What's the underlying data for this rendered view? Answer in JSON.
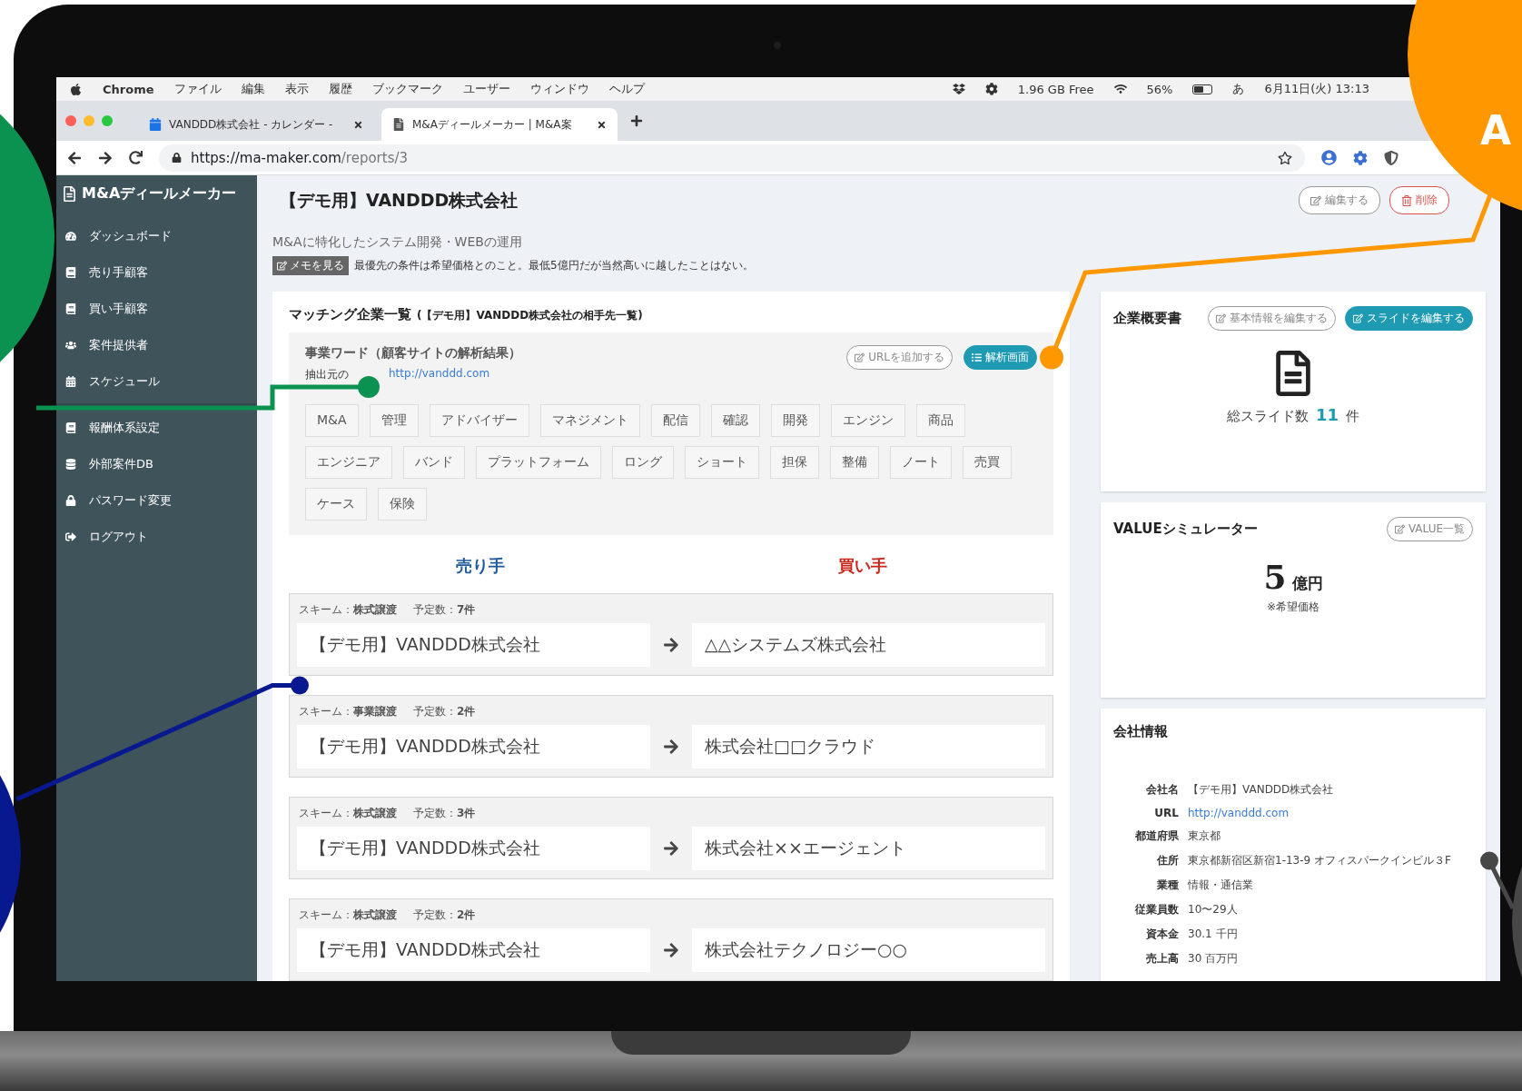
{
  "menubar": {
    "app": "Chrome",
    "menus": [
      "ファイル",
      "編集",
      "表示",
      "履歴",
      "ブックマーク",
      "ユーザー",
      "ウィンドウ",
      "ヘルプ"
    ],
    "memory": "1.96 GB Free",
    "battery": "56%",
    "ime": "あ",
    "clock": "6月11日(火) 13:13"
  },
  "browser": {
    "tabs": [
      {
        "title": "VANDDD株式会社 - カレンダー -",
        "selected": false
      },
      {
        "title": "M&Aディールメーカー | M&A案",
        "selected": true
      }
    ],
    "url_host": "https://ma-maker.com",
    "url_path": "/reports/3"
  },
  "sidebar": {
    "brand": "M&Aディールメーカー",
    "sections": [
      [
        "ダッシュボード",
        "売り手顧客",
        "買い手顧客",
        "案件提供者",
        "スケジュール"
      ],
      [
        "報酬体系設定",
        "外部案件DB",
        "パスワード変更",
        "ログアウト"
      ]
    ]
  },
  "report": {
    "title": "【デモ用】VANDDD株式会社",
    "actions": [
      {
        "label": "編集する",
        "kind": "edit"
      },
      {
        "label": "削除",
        "kind": "delete"
      }
    ],
    "description": "M&Aに特化したシステム開発・WEBの運用",
    "memo_button": "メモを見る",
    "memo": "最優先の条件は希望価格とのこと。最低5億円だが当然高いに越したことはない。"
  },
  "matching": {
    "title": "マッチング企業一覧",
    "subtitle": "(【デモ用】VANDDD株式会社の相手先一覧)",
    "keywords_heading": "事業ワード（顧客サイトの解析結果）",
    "source_label": "抽出元の",
    "source_url": "http://vanddd.com",
    "buttons": [
      {
        "label": "URLを追加する",
        "kind": "outline"
      },
      {
        "label": "解析画面",
        "kind": "primary"
      }
    ],
    "tags": [
      "M&A",
      "管理",
      "アドバイザー",
      "マネジメント",
      "配信",
      "確認",
      "開発",
      "エンジン",
      "商品",
      "エンジニア",
      "バンド",
      "プラットフォーム",
      "ロング",
      "ショート",
      "担保",
      "整備",
      "ノート",
      "売買",
      "ケース",
      "保険"
    ],
    "seller_heading": "売り手",
    "buyer_heading": "買い手",
    "deals": [
      {
        "scheme": "スキーム：**株式譲渡**",
        "planned": "予定数：**7件**",
        "seller": "【デモ用】VANDDD株式会社",
        "buyer": "△△システムズ株式会社"
      },
      {
        "scheme": "スキーム：**事業譲渡**",
        "planned": "予定数：**2件**",
        "seller": "【デモ用】VANDDD株式会社",
        "buyer": "株式会社□□クラウド"
      },
      {
        "scheme": "スキーム：**株式譲渡**",
        "planned": "予定数：**3件**",
        "seller": "【デモ用】VANDDD株式会社",
        "buyer": "株式会社××エージェント"
      },
      {
        "scheme": "スキーム：**株式譲渡**",
        "planned": "予定数：**2件**",
        "seller": "【デモ用】VANDDD株式会社",
        "buyer": "株式会社テクノロジー○○"
      }
    ]
  },
  "overview": {
    "title": "企業概要書",
    "buttons": [
      {
        "label": "基本情報を編集する",
        "kind": "outline"
      },
      {
        "label": "スライドを編集する",
        "kind": "primary"
      }
    ],
    "count_label": "総スライド数",
    "count": "11",
    "count_unit": "件"
  },
  "value": {
    "title": "VALUEシミュレーター",
    "button": "VALUE一覧",
    "amount": "5",
    "unit": "億円",
    "note": "※希望価格"
  },
  "company": {
    "title": "会社情報",
    "fields": [
      {
        "label": "会社名",
        "value": "【デモ用】VANDDD株式会社",
        "kind": "text"
      },
      {
        "label": "URL",
        "value": "http://vanddd.com",
        "kind": "link"
      },
      {
        "label": "都道府県",
        "value": "東京都",
        "kind": "text"
      },
      {
        "label": "住所",
        "value": "東京都新宿区新宿1-13-9 オフィスパークインビル３F",
        "kind": "text"
      },
      {
        "label": "業種",
        "value": "情報・通信業",
        "kind": "text"
      },
      {
        "label": "従業員数",
        "value": "10〜29人",
        "kind": "text"
      },
      {
        "label": "資本金",
        "value": "30.1 千円",
        "kind": "text"
      },
      {
        "label": "売上高",
        "value": "30 百万円",
        "kind": "text"
      }
    ]
  },
  "callouts": [
    {
      "color": "#0b9150"
    },
    {
      "color": "#ff9800",
      "text": "A"
    },
    {
      "color": "#08198f"
    },
    {
      "color": "#474747"
    }
  ]
}
